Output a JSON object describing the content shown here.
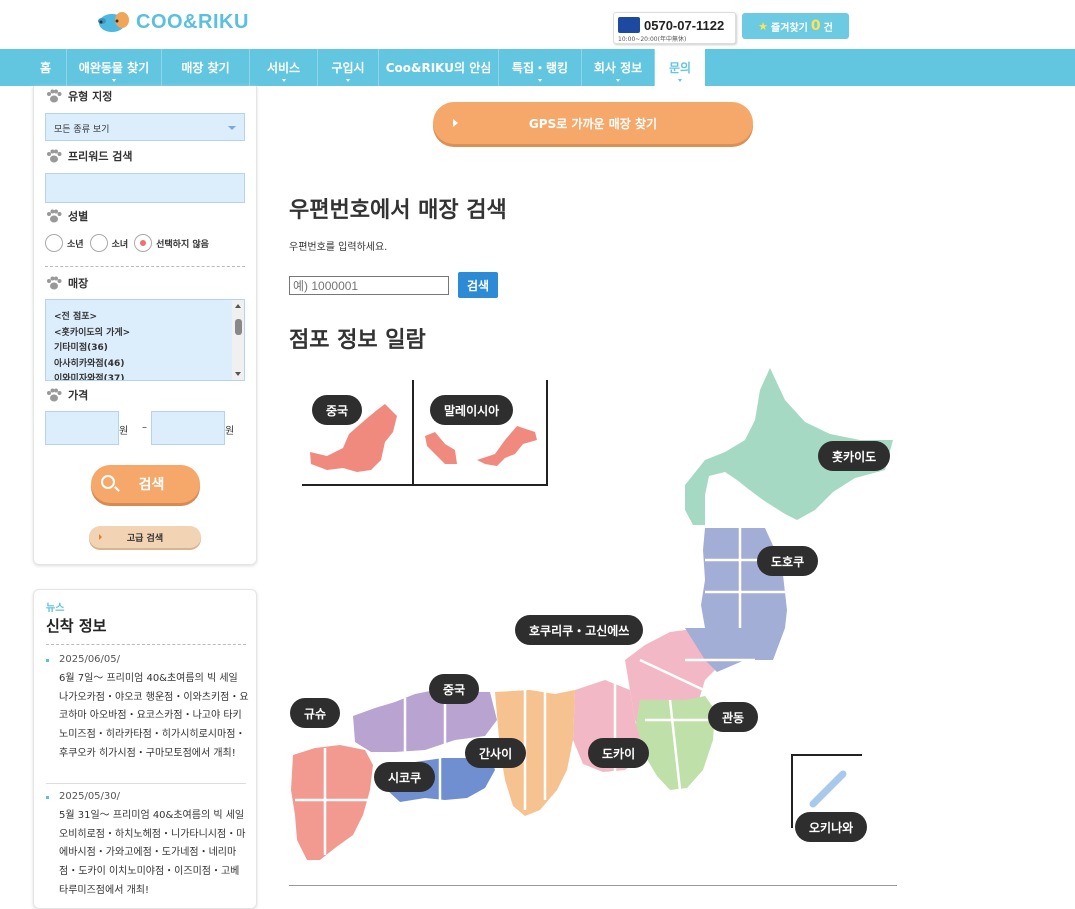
{
  "header": {
    "logo_text": "COO&RIKU",
    "phone": "0570-07-1122",
    "phone_hours": "10:00~20:00(年中無休)",
    "favorites_label": "즐겨찾기",
    "favorites_count": "0",
    "favorites_unit": "건"
  },
  "nav": {
    "items": [
      "홈",
      "애완동물 찾기",
      "매장 찾기",
      "서비스",
      "구입시",
      "Coo&RIKU의 안심",
      "특집・랭킹",
      "회사 정보",
      "문의"
    ]
  },
  "sidebar": {
    "type_label": "유형 지정",
    "type_value": "모든 종류 보기",
    "freeword_label": "프리워드 검색",
    "gender_label": "성별",
    "gender_options": [
      "소년",
      "소녀",
      "선택하지 않음"
    ],
    "store_label": "매장",
    "store_list": [
      "<전 점포>",
      "<홋카이도의 가게>",
      "기타미점(36)",
      "아사히카와점(46)",
      "이와미자와점(37)"
    ],
    "price_label": "가격",
    "price_unit": "원",
    "price_sep": "–",
    "search_button": "검색",
    "advanced_button": "고급 검색"
  },
  "news": {
    "label_en": "뉴스",
    "title": "신착 정보",
    "items": [
      {
        "date": "2025/06/05/",
        "body": "6월 7일〜 프리미엄 40&초여름의 빅 세일 나가오카점・야오코 행운점・이와츠키점・요코하마 아오바점・요코스카점・나고야 타키노미즈점・히라카타점・히가시히로시마점・후쿠오카 히가시점・구마모토점에서 개최!"
      },
      {
        "date": "2025/05/30/",
        "body": "5월 31일〜 프리미엄 40&초여름의 빅 세일 오비히로점・하치노헤점・니가타니시점・마에바시점・가와고에점・도가네점・네리마점・도카이 이치노미야점・이즈미점・고베 타루미즈점에서 개최!"
      }
    ]
  },
  "main": {
    "gps_button": "GPS로 가까운 매장 찾기",
    "zip_title": "우편번호에서 매장 검색",
    "zip_desc": "우편번호를 입력하세요.",
    "zip_placeholder": "예) 1000001",
    "zip_button": "검색",
    "list_title": "점포 정보 일람"
  },
  "map": {
    "regions": [
      "중국",
      "말레이시아",
      "홋카이도",
      "도호쿠",
      "호쿠리쿠・고신에쓰",
      "중국",
      "규슈",
      "간사이",
      "도카이",
      "관동",
      "시코쿠",
      "오키나와"
    ],
    "colors": {
      "china_abroad": "#f08a7e",
      "hokkaido": "#a6d9c4",
      "tohoku": "#a3aed6",
      "hokuriku": "#f3b8c6",
      "kanto": "#bfe0a8",
      "kansai": "#f6c28f",
      "chugoku": "#b9a3d0",
      "shikoku": "#6f8fd0",
      "kyushu": "#f29a90",
      "okinawa": "#a8c8ec"
    }
  }
}
